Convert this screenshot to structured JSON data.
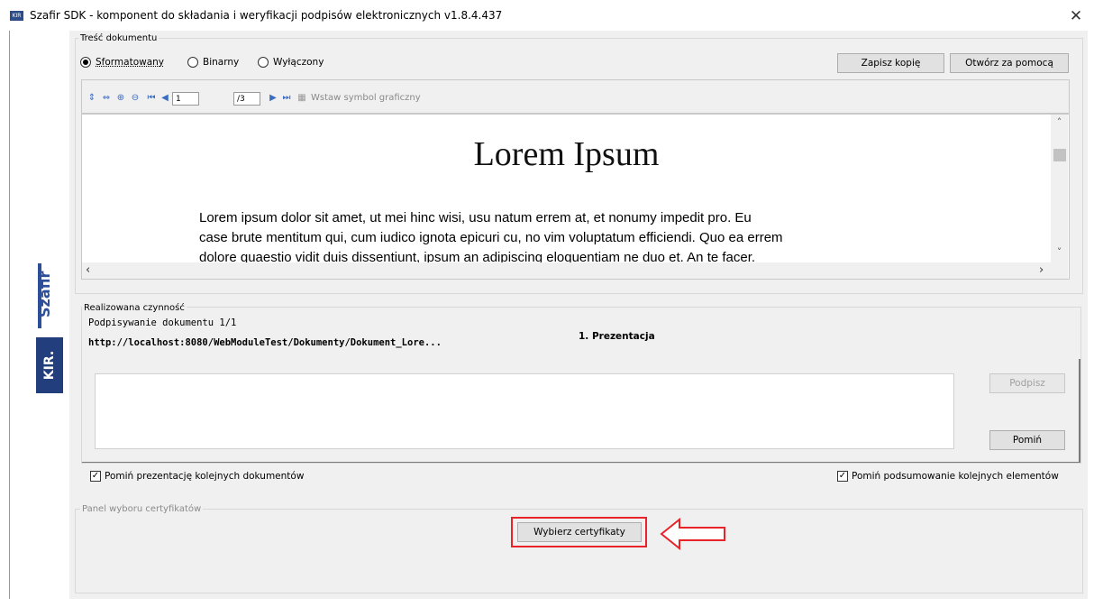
{
  "window": {
    "title": "Szafir SDK - komponent do składania i weryfikacji podpisów elektronicznych v1.8.4.437",
    "close_glyph": "✕",
    "app_icon_text": "KIR"
  },
  "brand": {
    "szafir": "Szafir",
    "kir": "KIR."
  },
  "document_content": {
    "group_title": "Treść dokumentu",
    "radios": [
      {
        "label": "Sformatowany",
        "checked": true
      },
      {
        "label": "Binarny",
        "checked": false
      },
      {
        "label": "Wyłączony",
        "checked": false
      }
    ],
    "save_copy_label": "Zapisz kopię",
    "open_with_label": "Otwórz za pomocą",
    "toolbar": {
      "page_current": "1",
      "page_total": "/3",
      "insert_symbol_label": "Wstaw symbol graficzny"
    },
    "preview": {
      "heading": "Lorem Ipsum",
      "line1": "Lorem ipsum dolor sit amet, ut mei hinc wisi, usu natum errem at, et nonumy impedit pro. Eu",
      "line2": "case brute mentitum qui, cum iudico ignota epicuri cu, no vim voluptatum efficiendi. Quo ea errem",
      "line3": "dolore quaestio vidit duis dissentiunt, ipsum an adipiscing eloquentiam ne duo et. An te facer."
    }
  },
  "activity": {
    "group_title": "Realizowana czynność",
    "signing_label": "Podpisywanie dokumentu 1/1",
    "url": "http://localhost:8080/WebModuleTest/Dokumenty/Dokument_Lore...",
    "step_label": "1. Prezentacja",
    "sign_button": "Podpisz",
    "skip_button": "Pomiń"
  },
  "options": {
    "skip_presentation": "Pomiń prezentację kolejnych dokumentów",
    "skip_summary": "Pomiń podsumowanie kolejnych elementów"
  },
  "certificates": {
    "group_title": "Panel wyboru certyfikatów",
    "choose_button": "Wybierz certyfikaty"
  },
  "colors": {
    "accent_highlight": "#e8232a",
    "brand_blue": "#2d4f9a"
  }
}
